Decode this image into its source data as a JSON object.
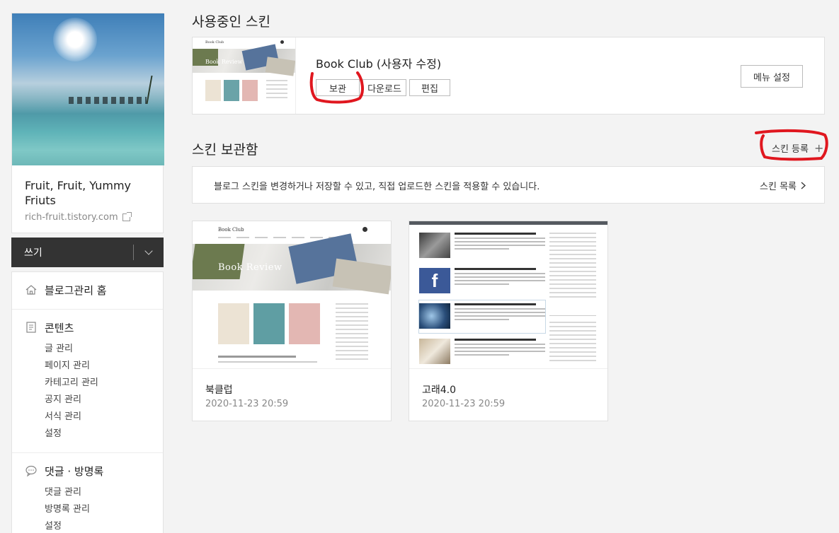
{
  "sidebar": {
    "blog_title": "Fruit, Fruit, Yummy Friuts",
    "blog_url": "rich-fruit.tistory.com",
    "write_label": "쓰기",
    "home_label": "블로그관리 홈",
    "contents": {
      "label": "콘텐츠",
      "items": [
        "글 관리",
        "페이지 관리",
        "카테고리 관리",
        "공지 관리",
        "서식 관리",
        "설정"
      ]
    },
    "comments": {
      "label": "댓글 · 방명록",
      "items": [
        "댓글 관리",
        "방명록 관리",
        "설정"
      ]
    }
  },
  "current_skin": {
    "section_title": "사용중인 스킨",
    "name": "Book Club (사용자 수정)",
    "buttons": {
      "save": "보관",
      "download": "다운로드",
      "edit": "편집"
    },
    "menu_settings": "메뉴 설정",
    "thumb_text": "Book Review"
  },
  "skin_storage": {
    "section_title": "스킨 보관함",
    "register_label": "스킨 등록",
    "info_text": "블로그 스킨을 변경하거나 저장할 수 있고, 직접 업로드한 스킨을 적용할 수 있습니다.",
    "list_link": "스킨 목록",
    "items": [
      {
        "name": "북클럽",
        "date": "2020-11-23 20:59",
        "thumb_title": "Book Club",
        "thumb_text": "Book Review"
      },
      {
        "name": "고래4.0",
        "date": "2020-11-23 20:59"
      }
    ]
  },
  "annotation_color": "#e0171f"
}
